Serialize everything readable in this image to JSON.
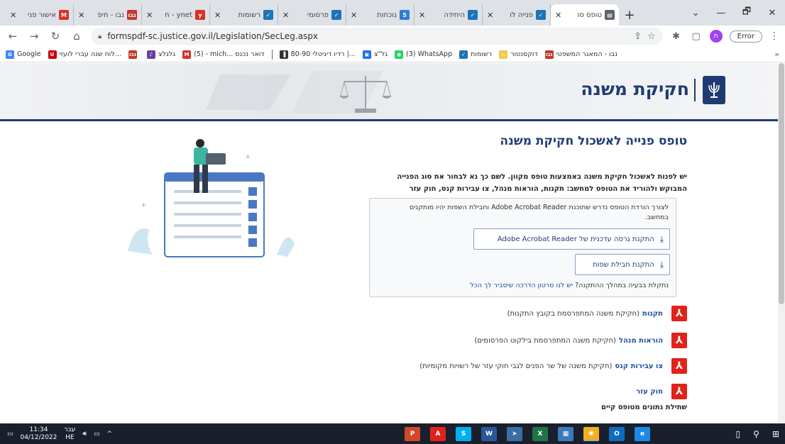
{
  "browser": {
    "tabs": [
      {
        "title": "אישור פני",
        "icon": "gmail-icon",
        "color": "#d93025",
        "glyph": "M"
      },
      {
        "title": "נבו - חיפ",
        "icon": "nevo-icon",
        "color": "#c0392b",
        "glyph": "נבו"
      },
      {
        "title": "ynet - ח",
        "icon": "ynet-icon",
        "color": "#d93025",
        "glyph": "y"
      },
      {
        "title": "רשומות",
        "icon": "check-icon",
        "color": "#1f73b7",
        "glyph": "✓"
      },
      {
        "title": "פרסומי",
        "icon": "check-icon",
        "color": "#1f73b7",
        "glyph": "✓"
      },
      {
        "title": "נוכחות",
        "icon": "app-icon",
        "color": "#2b7fd1",
        "glyph": "5"
      },
      {
        "title": "היחידה",
        "icon": "check-icon",
        "color": "#1f73b7",
        "glyph": "✓"
      },
      {
        "title": "פנייה לו",
        "icon": "check-icon",
        "color": "#1f73b7",
        "glyph": "✓"
      },
      {
        "title": "טופס סו",
        "icon": "page-icon",
        "color": "#5f6368",
        "glyph": "▤",
        "active": true
      }
    ],
    "new_tab": "+",
    "window_controls": {
      "chevron": "⌄",
      "minimize": "—",
      "restore": "🗗",
      "close": "✕"
    },
    "url": "formspdf-sc.justice.gov.il/Legislation/SecLeg.aspx",
    "profile_initial": "ת",
    "error_label": "Error",
    "bookmarks": [
      {
        "label": "Google",
        "color": "#4285f4",
        "glyph": "G"
      },
      {
        "label": "לוח שנה עברי לועזי...",
        "color": "#c00",
        "glyph": "U"
      },
      {
        "label": "",
        "color": "#c0392b",
        "glyph": "נבו"
      },
      {
        "label": "גלגלצ",
        "color": "#6b3fa0",
        "glyph": "♪"
      },
      {
        "label": "(5) - mich... דואר נכנס",
        "color": "#d93025",
        "glyph": "M"
      },
      {
        "label": "רדיו דיגיטלי 80-90 |...",
        "color": "#333",
        "glyph": "▐"
      },
      {
        "label": "גל\"צ",
        "color": "#1a73e8",
        "glyph": "▣"
      },
      {
        "label": "(3) WhatsApp",
        "color": "#25d366",
        "glyph": "◉"
      },
      {
        "label": "רשומות",
        "color": "#1f73b7",
        "glyph": "✓"
      },
      {
        "label": "דוקסנטור",
        "color": "#f2c94c",
        "glyph": "▭"
      },
      {
        "label": "נבו - המאגר המשפטי",
        "color": "#c0392b",
        "glyph": "נבו"
      }
    ]
  },
  "page": {
    "site_title": "חקיקת משנה",
    "heading": "טופס פנייה לאשכול חקיקת משנה",
    "intro": "יש לפנות לאשכול חקיקת משנה באמצעות טופס מקוון. לשם כך נא לבחור את סוג הפנייה המבוקש ולהוריד את הטופס למחשב: תקנות, הוראות מנהל, צו עבירות קנס, חוק עזר",
    "info_text": "לצורך הורדת הטופס נדרש שתוכנת Adobe Acrobat Reader וחבילת השפות יהיו מותקנים במחשב.",
    "btn_install_reader": "התקנת גרסה עדכנית של Adobe Acrobat Reader",
    "btn_install_langpack": "התקנת חבילת שפות",
    "help_prefix": "נתקלת בבעיה במהלך ההתקנה?",
    "help_link": "יש לנו סרטון הדרכה שיסביר לך הכל",
    "forms": [
      {
        "name": "תקנות",
        "desc": "(חקיקת משנה המתפרסמת בקובץ התקנות)"
      },
      {
        "name": "הוראות מנהל",
        "desc": "(חקיקת משנה המתפרסמת בילקוט הפרסומים)"
      },
      {
        "name": "צו עבירות קנס",
        "desc": "(חקיקת משנה של שר הפנים לגבי חוקי עזר של רשויות מקומיות)"
      },
      {
        "name": "חוק עזר",
        "desc": ""
      }
    ],
    "existing_data": "שתילת נתונים מטופס קיים"
  },
  "taskbar": {
    "time": "11:34",
    "date": "04/12/2022",
    "lang_top": "עבר",
    "lang_bottom": "HE",
    "apps": [
      {
        "name": "powerpoint-icon",
        "color": "#d24726",
        "glyph": "P"
      },
      {
        "name": "acrobat-icon",
        "color": "#e1221b",
        "glyph": "A"
      },
      {
        "name": "skype-icon",
        "color": "#00aff0",
        "glyph": "S"
      },
      {
        "name": "word-icon",
        "color": "#2b579a",
        "glyph": "W"
      },
      {
        "name": "arrow-app-icon",
        "color": "#3a6ea5",
        "glyph": "➤"
      },
      {
        "name": "excel-icon",
        "color": "#217346",
        "glyph": "X"
      },
      {
        "name": "photo-app-icon",
        "color": "#3d7ab8",
        "glyph": "▦"
      },
      {
        "name": "chrome-icon",
        "color": "#f2b01e",
        "glyph": "◉"
      },
      {
        "name": "outlook-icon",
        "color": "#0f6cbd",
        "glyph": "O"
      },
      {
        "name": "edge-icon",
        "color": "#1e88e5",
        "glyph": "e"
      }
    ]
  }
}
